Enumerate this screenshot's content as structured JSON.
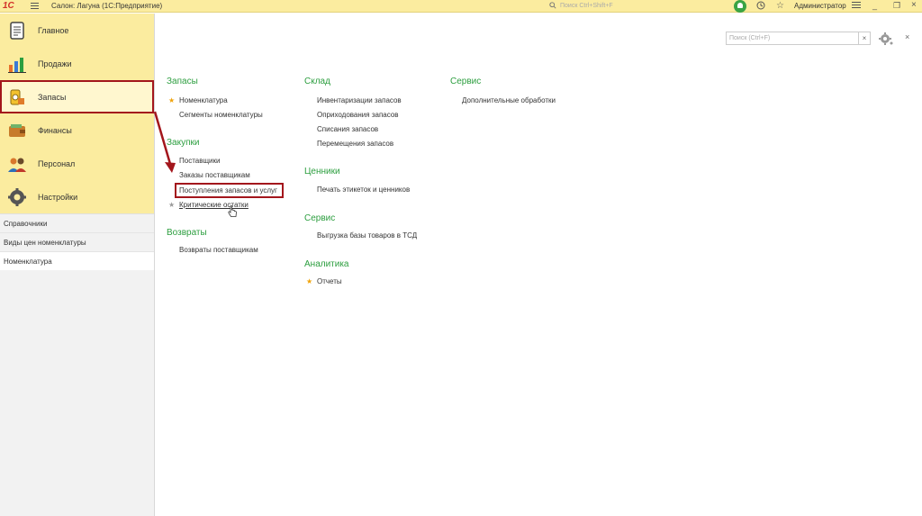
{
  "titlebar": {
    "logo": "1С",
    "app_title": "Салон: Лагуна  (1С:Предприятие)",
    "search_placeholder": "Поиск Ctrl+Shift+F",
    "user": "Администратор"
  },
  "sidebar": {
    "sections": [
      {
        "label": "Главное",
        "icon": "notepad-icon"
      },
      {
        "label": "Продажи",
        "icon": "sales-chart-icon"
      },
      {
        "label": "Запасы",
        "icon": "stock-icon",
        "active": true
      },
      {
        "label": "Финансы",
        "icon": "wallet-icon"
      },
      {
        "label": "Персонал",
        "icon": "people-icon"
      },
      {
        "label": "Настройки",
        "icon": "gear-icon"
      }
    ],
    "nav": [
      {
        "label": "Справочники"
      },
      {
        "label": "Виды цен номенклатуры"
      },
      {
        "label": "Номенклатура",
        "current": true
      }
    ]
  },
  "panel": {
    "search_placeholder": "Поиск (Ctrl+F)",
    "clear_label": "×",
    "close_label": "×"
  },
  "groups": {
    "zapasy": {
      "title": "Запасы",
      "items": [
        "Номенклатура",
        "Сегменты номенклатуры"
      ]
    },
    "zakupki": {
      "title": "Закупки",
      "items": [
        "Поставщики",
        "Заказы поставщикам",
        "Поступления запасов и услуг",
        "Критические остатки"
      ]
    },
    "vozvraty": {
      "title": "Возвраты",
      "items": [
        "Возвраты поставщикам"
      ]
    },
    "sklad": {
      "title": "Склад",
      "items": [
        "Инвентаризации запасов",
        "Оприходования запасов",
        "Списания запасов",
        "Перемещения запасов"
      ]
    },
    "cenniki": {
      "title": "Ценники",
      "items": [
        "Печать этикеток и ценников"
      ]
    },
    "servis2": {
      "title": "Сервис",
      "items": [
        "Выгрузка базы товаров в ТСД"
      ]
    },
    "analitika": {
      "title": "Аналитика",
      "items": [
        "Отчеты"
      ]
    },
    "servis": {
      "title": "Сервис",
      "items": [
        "Дополнительные обработки"
      ]
    }
  },
  "colors": {
    "accent_green": "#2c9e3f",
    "sidebar_yellow": "#fbec9f",
    "highlight_red": "#a3161c",
    "star_gold": "#f0a30a"
  }
}
